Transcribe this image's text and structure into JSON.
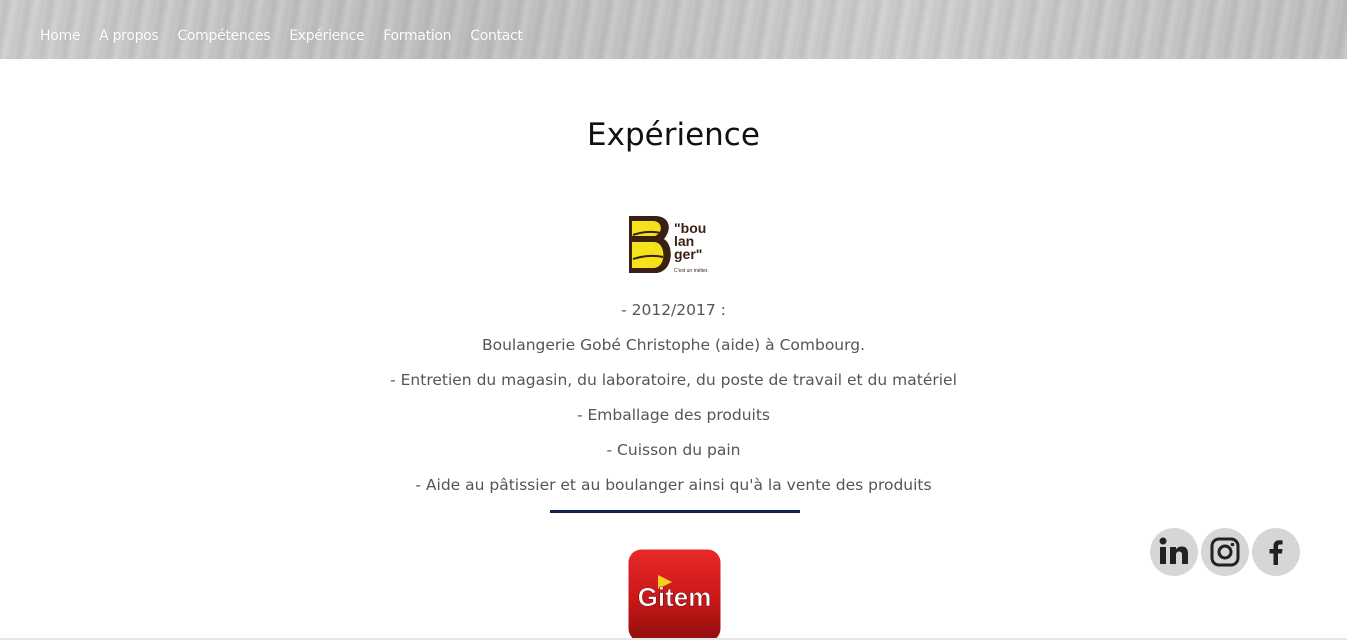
{
  "nav": {
    "items": [
      {
        "label": "Home"
      },
      {
        "label": "A propos"
      },
      {
        "label": "Compétences"
      },
      {
        "label": "Expérience"
      },
      {
        "label": "Formation"
      },
      {
        "label": "Contact"
      }
    ]
  },
  "main": {
    "title": "Expérience",
    "experience": {
      "logo": {
        "icon": "boulanger-logo",
        "line1": "\"bou",
        "line2": "lan",
        "line3": "ger\"",
        "tagline": "C'est un métier.",
        "letter": "B"
      },
      "lines": [
        "- 2012/2017 :",
        "Boulangerie Gobé Christophe (aide) à Combourg.",
        "- Entretien du magasin, du laboratoire, du poste de travail et du matériel",
        "- Emballage des produits",
        "- Cuisson du pain",
        "- Aide au pâtissier et au boulanger ainsi qu'à la vente des produits"
      ]
    },
    "next_logo": {
      "icon": "gitem-logo",
      "text": "Gitem"
    }
  },
  "social": [
    {
      "icon": "linkedin-icon"
    },
    {
      "icon": "instagram-icon"
    },
    {
      "icon": "facebook-icon"
    }
  ],
  "colors": {
    "divider": "#10204f",
    "logo_yellow": "#f5e11c",
    "logo_brown": "#3a1f12",
    "gitem_red": "#d41f1f"
  }
}
